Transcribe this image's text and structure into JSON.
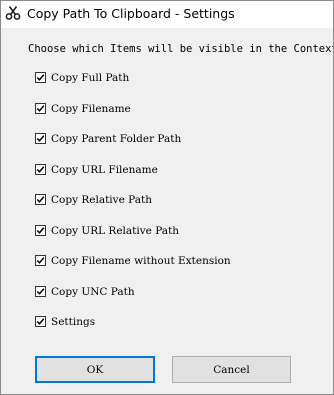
{
  "window": {
    "title": "Copy Path To Clipboard - Settings",
    "icon": "scissors-icon"
  },
  "prompt": "Choose which Items will be visible in the Context M",
  "options": [
    {
      "label": "Copy Full Path",
      "checked": true
    },
    {
      "label": "Copy Filename",
      "checked": true
    },
    {
      "label": "Copy Parent Folder Path",
      "checked": true
    },
    {
      "label": "Copy URL Filename",
      "checked": true
    },
    {
      "label": "Copy Relative Path",
      "checked": true
    },
    {
      "label": "Copy URL Relative Path",
      "checked": true
    },
    {
      "label": "Copy Filename without Extension",
      "checked": true
    },
    {
      "label": "Copy UNC Path",
      "checked": true
    },
    {
      "label": "Settings",
      "checked": true
    }
  ],
  "buttons": {
    "ok": "OK",
    "cancel": "Cancel"
  },
  "colors": {
    "focus_border": "#0078d7",
    "dialog_bg": "#f0f0f0",
    "button_bg": "#e1e1e1"
  }
}
